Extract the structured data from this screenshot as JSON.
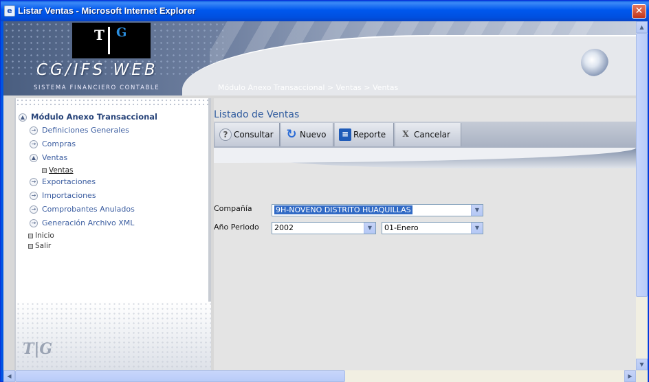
{
  "window": {
    "title": "Listar Ventas - Microsoft Internet Explorer"
  },
  "header": {
    "logo_t": "T",
    "logo_g": "G",
    "brand": "CG/IFS  WEB",
    "brand_sub": "SISTEMA FINANCIERO CONTABLE",
    "breadcrumb": "Módulo Anexo Transaccional > Ventas > Ventas"
  },
  "sidebar": {
    "heading": "Módulo Anexo Transaccional",
    "items": [
      {
        "label": "Definiciones Generales"
      },
      {
        "label": "Compras"
      },
      {
        "label": "Ventas"
      },
      {
        "label": "Exportaciones"
      },
      {
        "label": "Importaciones"
      },
      {
        "label": "Comprobantes Anulados"
      },
      {
        "label": "Generación Archivo XML"
      }
    ],
    "sub_item": "Ventas",
    "misc": [
      {
        "label": "Inicio"
      },
      {
        "label": "Salir"
      }
    ],
    "bottom_logo": "T|G"
  },
  "main": {
    "title": "Listado de Ventas",
    "toolbar": {
      "consultar": "Consultar",
      "nuevo": "Nuevo",
      "reporte": "Reporte",
      "cancelar": "Cancelar"
    },
    "form": {
      "compania_label": "Compañía",
      "compania_value": "9H-NOVENO DISTRITO HUAQUILLAS",
      "periodo_label": "Año Periodo",
      "anio_value": "2002",
      "mes_value": "01-Enero"
    }
  },
  "colors": {
    "accent": "#2f5b9e",
    "title_bar": "#0058ee",
    "selection": "#316ac5"
  }
}
